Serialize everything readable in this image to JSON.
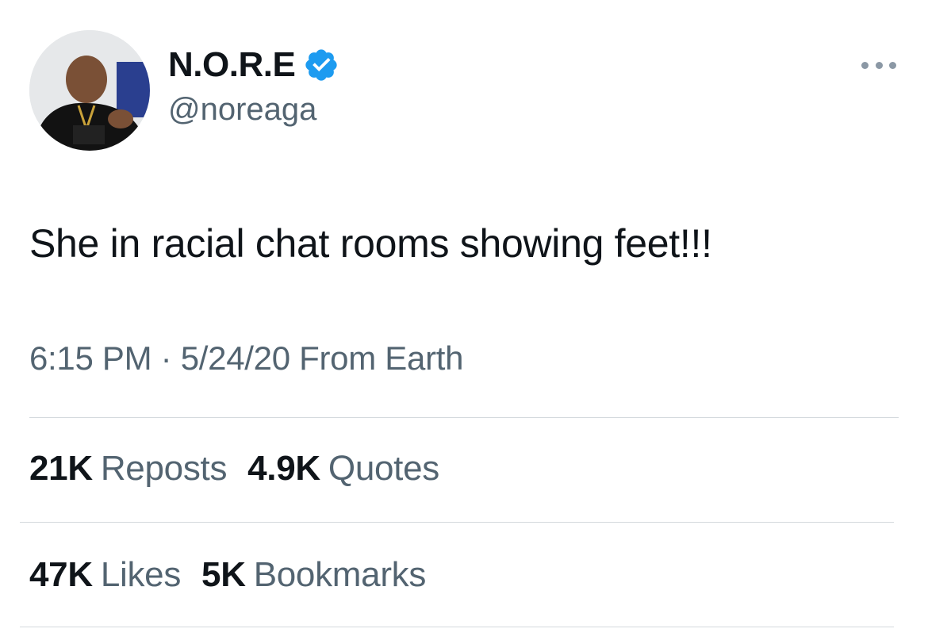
{
  "author": {
    "display_name": "N.O.R.E",
    "handle": "@noreaga",
    "verified_icon": "verified-badge-icon",
    "verified_color": "#1d9bf0"
  },
  "tweet": {
    "text": "She in racial chat rooms showing feet!!!",
    "meta": "6:15 PM · 5/24/20 From Earth"
  },
  "stats": {
    "reposts": {
      "value": "21K",
      "label": "Reposts"
    },
    "quotes": {
      "value": "4.9K",
      "label": "Quotes"
    },
    "likes": {
      "value": "47K",
      "label": "Likes"
    },
    "bookmarks": {
      "value": "5K",
      "label": "Bookmarks"
    }
  },
  "more_icon": "more-options-icon"
}
